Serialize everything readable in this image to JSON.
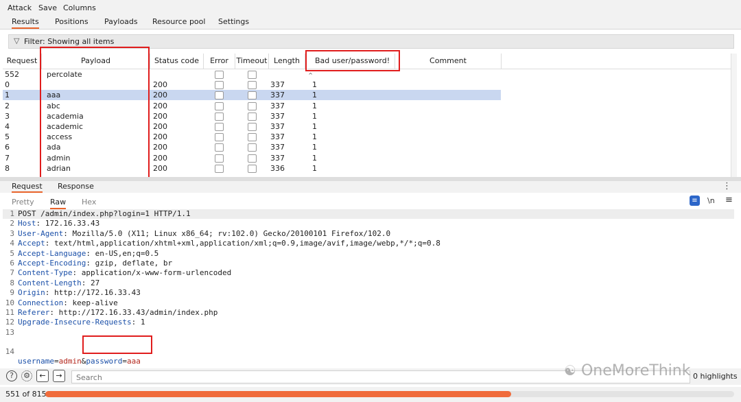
{
  "menu": [
    "Attack",
    "Save",
    "Columns"
  ],
  "tabs": [
    "Results",
    "Positions",
    "Payloads",
    "Resource pool",
    "Settings"
  ],
  "filter_text": "Filter: Showing all items",
  "table": {
    "columns": [
      "Request",
      "Payload",
      "Status code",
      "Error",
      "Timeout",
      "Length",
      "Bad user/password!",
      "Comment"
    ],
    "sorted_column": "Bad user/password!",
    "rows": [
      {
        "request": "552",
        "payload": "percolate",
        "status": "",
        "length": "",
        "bad": "",
        "selected": false
      },
      {
        "request": "0",
        "payload": "",
        "status": "200",
        "length": "337",
        "bad": "1",
        "selected": false
      },
      {
        "request": "1",
        "payload": "aaa",
        "status": "200",
        "length": "337",
        "bad": "1",
        "selected": true
      },
      {
        "request": "2",
        "payload": "abc",
        "status": "200",
        "length": "337",
        "bad": "1",
        "selected": false
      },
      {
        "request": "3",
        "payload": "academia",
        "status": "200",
        "length": "337",
        "bad": "1",
        "selected": false
      },
      {
        "request": "4",
        "payload": "academic",
        "status": "200",
        "length": "337",
        "bad": "1",
        "selected": false
      },
      {
        "request": "5",
        "payload": "access",
        "status": "200",
        "length": "337",
        "bad": "1",
        "selected": false
      },
      {
        "request": "6",
        "payload": "ada",
        "status": "200",
        "length": "337",
        "bad": "1",
        "selected": false
      },
      {
        "request": "7",
        "payload": "admin",
        "status": "200",
        "length": "337",
        "bad": "1",
        "selected": false
      },
      {
        "request": "8",
        "payload": "adrian",
        "status": "200",
        "length": "336",
        "bad": "1",
        "selected": false
      }
    ]
  },
  "panel_tabs": [
    "Request",
    "Response"
  ],
  "view_tabs": [
    "Pretty",
    "Raw",
    "Hex"
  ],
  "active_view": "Raw",
  "newline_label": "\\n",
  "request_lines": [
    {
      "n": "1",
      "key": "",
      "sep": "",
      "val": "POST /admin/index.php?login=1 HTTP/1.1"
    },
    {
      "n": "2",
      "key": "Host",
      "sep": ": ",
      "val": "172.16.33.43"
    },
    {
      "n": "3",
      "key": "User-Agent",
      "sep": ": ",
      "val": "Mozilla/5.0 (X11; Linux x86_64; rv:102.0) Gecko/20100101 Firefox/102.0"
    },
    {
      "n": "4",
      "key": "Accept",
      "sep": ": ",
      "val": "text/html,application/xhtml+xml,application/xml;q=0.9,image/avif,image/webp,*/*;q=0.8"
    },
    {
      "n": "5",
      "key": "Accept-Language",
      "sep": ": ",
      "val": "en-US,en;q=0.5"
    },
    {
      "n": "6",
      "key": "Accept-Encoding",
      "sep": ": ",
      "val": "gzip, deflate, br"
    },
    {
      "n": "7",
      "key": "Content-Type",
      "sep": ": ",
      "val": "application/x-www-form-urlencoded"
    },
    {
      "n": "8",
      "key": "Content-Length",
      "sep": ": ",
      "val": "27"
    },
    {
      "n": "9",
      "key": "Origin",
      "sep": ": ",
      "val": "http://172.16.33.43"
    },
    {
      "n": "10",
      "key": "Connection",
      "sep": ": ",
      "val": "keep-alive"
    },
    {
      "n": "11",
      "key": "Referer",
      "sep": ": ",
      "val": "http://172.16.33.43/admin/index.php"
    },
    {
      "n": "12",
      "key": "Upgrade-Insecure-Requests",
      "sep": ": ",
      "val": "1"
    },
    {
      "n": "13",
      "key": "",
      "sep": "",
      "val": ""
    }
  ],
  "body_line": {
    "n": "14",
    "k1": "username",
    "eq1": "=",
    "v1": "admin",
    "amp": "&",
    "k2": "password",
    "eq2": "=",
    "v2": "aaa"
  },
  "search_placeholder": "Search",
  "highlights_text": "0 highlights",
  "progress_text": "551 of 815",
  "progress_fraction": 0.676,
  "watermark_text": "OneMoreThink",
  "colors": {
    "accent": "#e8632a",
    "annotation_red": "#e01c1c",
    "selected_row": "#c9d7f0",
    "progress": "#f06b3b"
  }
}
